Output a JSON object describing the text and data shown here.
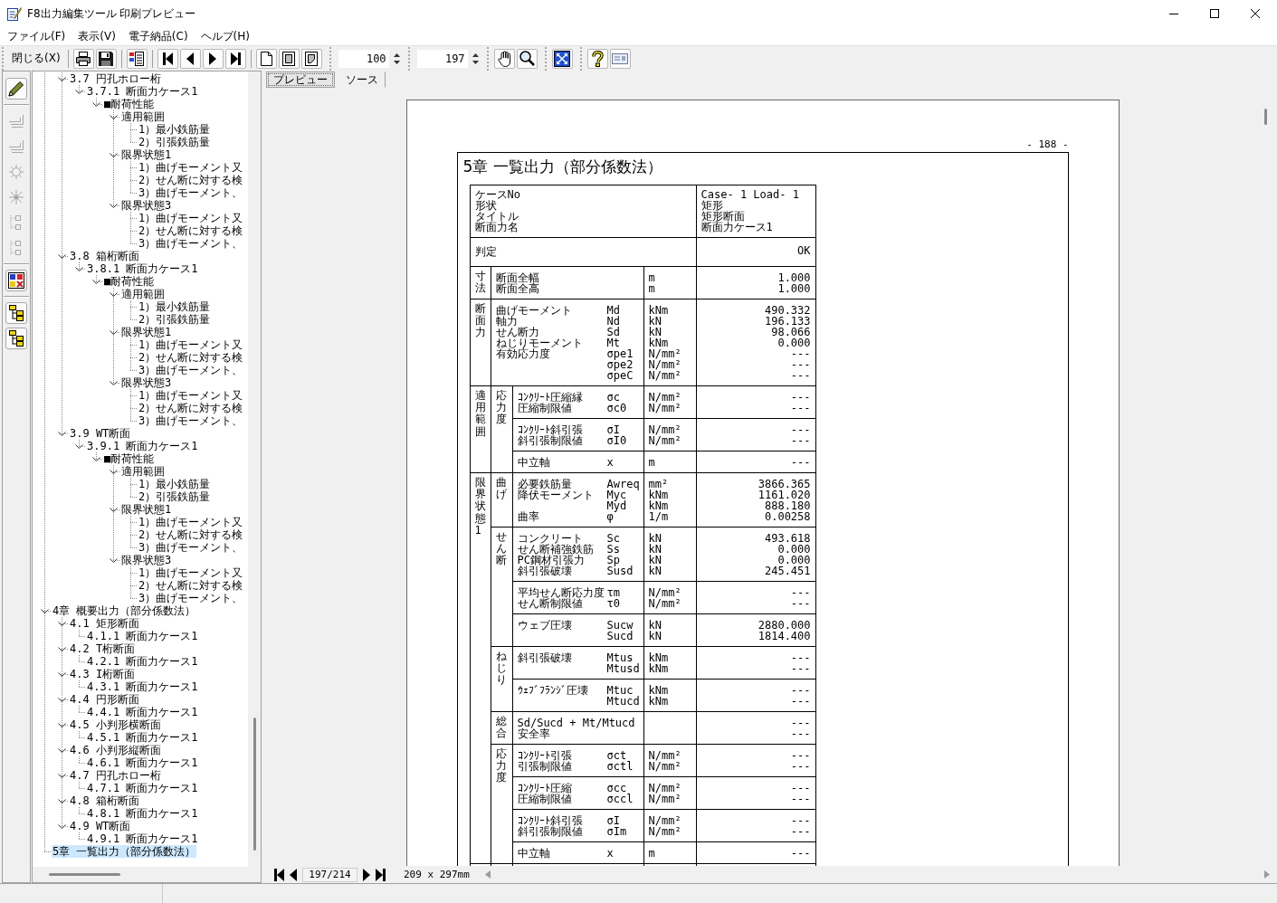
{
  "window": {
    "title": "F8出力編集ツール 印刷プレビュー"
  },
  "menu": [
    "ファイル(F)",
    "表示(V)",
    "電子納品(C)",
    "ヘルプ(H)"
  ],
  "toolbar": {
    "close_button": "閉じる(X)",
    "number_fields": [
      "100",
      "197"
    ]
  },
  "tool_strip": [
    [
      {
        "kind": "pencil",
        "disabled": false
      }
    ],
    [
      {
        "kind": "stack",
        "disabled": true
      },
      {
        "kind": "stack",
        "disabled": true
      },
      {
        "kind": "wheel",
        "disabled": true
      },
      {
        "kind": "burst",
        "disabled": true
      },
      {
        "kind": "nodes",
        "disabled": true
      },
      {
        "kind": "nodes",
        "disabled": true
      }
    ],
    [
      {
        "kind": "blocks",
        "disabled": false
      }
    ],
    [
      {
        "kind": "tree",
        "disabled": false
      },
      {
        "kind": "tree",
        "disabled": false
      }
    ]
  ],
  "tree": {
    "continued_children": [
      {
        "label": "3.7 円孔ホロー桁",
        "expanded": true,
        "selected": false,
        "children": [
          {
            "label": "3.7.1 断面力ケース1",
            "expanded": true,
            "selected": false,
            "children": [
              {
                "label": "■耐荷性能",
                "expanded": true,
                "selected": false,
                "children": [
                  {
                    "label": "適用範囲",
                    "expanded": true,
                    "selected": false,
                    "children": [
                      {
                        "label": "1）最小鉄筋量",
                        "selected": false
                      },
                      {
                        "label": "2）引張鉄筋量",
                        "selected": false
                      }
                    ]
                  },
                  {
                    "label": "限界状態1",
                    "expanded": true,
                    "selected": false,
                    "children": [
                      {
                        "label": "1）曲げモーメント又",
                        "selected": false
                      },
                      {
                        "label": "2）せん断に対する検",
                        "selected": false
                      },
                      {
                        "label": "3）曲げモーメント、",
                        "selected": false
                      }
                    ]
                  },
                  {
                    "label": "限界状態3",
                    "expanded": true,
                    "selected": false,
                    "children": [
                      {
                        "label": "1）曲げモーメント又",
                        "selected": false
                      },
                      {
                        "label": "2）せん断に対する検",
                        "selected": false
                      },
                      {
                        "label": "3）曲げモーメント、",
                        "selected": false
                      }
                    ]
                  }
                ]
              }
            ]
          }
        ]
      },
      {
        "label": "3.8 箱桁断面",
        "expanded": true,
        "selected": false,
        "children": [
          {
            "label": "3.8.1 断面力ケース1",
            "expanded": true,
            "selected": false,
            "children": [
              {
                "label": "■耐荷性能",
                "expanded": true,
                "selected": false,
                "children": [
                  {
                    "label": "適用範囲",
                    "expanded": true,
                    "selected": false,
                    "children": [
                      {
                        "label": "1）最小鉄筋量",
                        "selected": false
                      },
                      {
                        "label": "2）引張鉄筋量",
                        "selected": false
                      }
                    ]
                  },
                  {
                    "label": "限界状態1",
                    "expanded": true,
                    "selected": false,
                    "children": [
                      {
                        "label": "1）曲げモーメント又",
                        "selected": false
                      },
                      {
                        "label": "2）せん断に対する検",
                        "selected": false
                      },
                      {
                        "label": "3）曲げモーメント、",
                        "selected": false
                      }
                    ]
                  },
                  {
                    "label": "限界状態3",
                    "expanded": true,
                    "selected": false,
                    "children": [
                      {
                        "label": "1）曲げモーメント又",
                        "selected": false
                      },
                      {
                        "label": "2）せん断に対する検",
                        "selected": false
                      },
                      {
                        "label": "3）曲げモーメント、",
                        "selected": false
                      }
                    ]
                  }
                ]
              }
            ]
          }
        ]
      },
      {
        "label": "3.9 WT断面",
        "expanded": true,
        "selected": false,
        "children": [
          {
            "label": "3.9.1 断面力ケース1",
            "expanded": true,
            "selected": false,
            "children": [
              {
                "label": "■耐荷性能",
                "expanded": true,
                "selected": false,
                "children": [
                  {
                    "label": "適用範囲",
                    "expanded": true,
                    "selected": false,
                    "children": [
                      {
                        "label": "1）最小鉄筋量",
                        "selected": false
                      },
                      {
                        "label": "2）引張鉄筋量",
                        "selected": false
                      }
                    ]
                  },
                  {
                    "label": "限界状態1",
                    "expanded": true,
                    "selected": false,
                    "children": [
                      {
                        "label": "1）曲げモーメント又",
                        "selected": false
                      },
                      {
                        "label": "2）せん断に対する検",
                        "selected": false
                      },
                      {
                        "label": "3）曲げモーメント、",
                        "selected": false
                      }
                    ]
                  },
                  {
                    "label": "限界状態3",
                    "expanded": true,
                    "selected": false,
                    "children": [
                      {
                        "label": "1）曲げモーメント又",
                        "selected": false
                      },
                      {
                        "label": "2）せん断に対する検",
                        "selected": false
                      },
                      {
                        "label": "3）曲げモーメント、",
                        "selected": false
                      }
                    ]
                  }
                ]
              }
            ]
          }
        ]
      }
    ],
    "items": [
      {
        "label": "4章 概要出力（部分係数法）",
        "expanded": true,
        "selected": false,
        "children": [
          {
            "label": "4.1 矩形断面",
            "expanded": true,
            "selected": false,
            "children": [
              {
                "label": "4.1.1 断面力ケース1",
                "selected": false
              }
            ]
          },
          {
            "label": "4.2 T桁断面",
            "expanded": true,
            "selected": false,
            "children": [
              {
                "label": "4.2.1 断面力ケース1",
                "selected": false
              }
            ]
          },
          {
            "label": "4.3 I桁断面",
            "expanded": true,
            "selected": false,
            "children": [
              {
                "label": "4.3.1 断面力ケース1",
                "selected": false
              }
            ]
          },
          {
            "label": "4.4 円形断面",
            "expanded": true,
            "selected": false,
            "children": [
              {
                "label": "4.4.1 断面力ケース1",
                "selected": false
              }
            ]
          },
          {
            "label": "4.5 小判形横断面",
            "expanded": true,
            "selected": false,
            "children": [
              {
                "label": "4.5.1 断面力ケース1",
                "selected": false
              }
            ]
          },
          {
            "label": "4.6 小判形縦断面",
            "expanded": true,
            "selected": false,
            "children": [
              {
                "label": "4.6.1 断面力ケース1",
                "selected": false
              }
            ]
          },
          {
            "label": "4.7 円孔ホロー桁",
            "expanded": true,
            "selected": false,
            "children": [
              {
                "label": "4.7.1 断面力ケース1",
                "selected": false
              }
            ]
          },
          {
            "label": "4.8 箱桁断面",
            "expanded": true,
            "selected": false,
            "children": [
              {
                "label": "4.8.1 断面力ケース1",
                "selected": false
              }
            ]
          },
          {
            "label": "4.9 WT断面",
            "expanded": true,
            "selected": false,
            "children": [
              {
                "label": "4.9.1 断面力ケース1",
                "selected": false
              }
            ]
          }
        ]
      },
      {
        "label": "5章 一覧出力（部分係数法）",
        "selected": true
      }
    ]
  },
  "tabs": [
    {
      "label": "プレビュー",
      "selected": true
    },
    {
      "label": "ソース",
      "selected": false
    }
  ],
  "preview": {
    "page_number": "- 188 -",
    "heading": "5章 一覧出力（部分係数法）",
    "table": {
      "header": {
        "labels": [
          "ケースNo",
          "形状",
          "タイトル",
          "断面力名"
        ],
        "values": [
          "Case- 1 Load- 1",
          "矩形",
          "矩形断面",
          "断面力ケース1"
        ]
      },
      "verdict": {
        "label": "判定",
        "value": "OK"
      },
      "groups": [
        {
          "label": "寸法",
          "blocks": [
            {
              "lines": [
                {
                  "item": "断面全幅",
                  "unit": "m",
                  "value": "1.000"
                },
                {
                  "item": "断面全高",
                  "unit": "m",
                  "value": "1.000"
                }
              ]
            }
          ]
        },
        {
          "label": "断面力",
          "blocks": [
            {
              "lines": [
                {
                  "item": "曲げモーメント",
                  "symbol": "Md",
                  "unit": "kNm",
                  "value": "490.332"
                },
                {
                  "item": "軸力",
                  "symbol": "Nd",
                  "unit": "kN",
                  "value": "196.133"
                },
                {
                  "item": "せん断力",
                  "symbol": "Sd",
                  "unit": "kN",
                  "value": "98.066"
                },
                {
                  "item": "ねじりモーメント",
                  "symbol": "Mt",
                  "unit": "kNm",
                  "value": "0.000"
                },
                {
                  "item": "有効応力度",
                  "symbol": "σpe1",
                  "unit": "N/mm²",
                  "value": "---"
                },
                {
                  "symbol": "σpe2",
                  "unit": "N/mm²",
                  "value": "---"
                },
                {
                  "symbol": "σpeC",
                  "unit": "N/mm²",
                  "value": "---"
                }
              ]
            }
          ]
        },
        {
          "label": "適用範囲",
          "subgroups": [
            {
              "label": "応力度",
              "blocks": [
                {
                  "lines": [
                    {
                      "item": "ｺﾝｸﾘｰﾄ圧縮縁",
                      "symbol": "σc",
                      "unit": "N/mm²",
                      "value": "---"
                    },
                    {
                      "item": "圧縮制限値",
                      "symbol": "σc0",
                      "unit": "N/mm²",
                      "value": "---"
                    }
                  ]
                },
                {
                  "lines": [
                    {
                      "item": "ｺﾝｸﾘｰﾄ斜引張",
                      "symbol": "σI",
                      "unit": "N/mm²",
                      "value": "---"
                    },
                    {
                      "item": "斜引張制限値",
                      "symbol": "σI0",
                      "unit": "N/mm²",
                      "value": "---"
                    }
                  ]
                },
                {
                  "lines": [
                    {
                      "item": "中立軸",
                      "symbol": "x",
                      "unit": "m",
                      "value": "---"
                    }
                  ]
                }
              ]
            }
          ]
        },
        {
          "label": "限界状態1",
          "subgroups": [
            {
              "label": "曲げ",
              "blocks": [
                {
                  "lines": [
                    {
                      "item": "必要鉄筋量",
                      "symbol": "Awreq",
                      "unit": "mm²",
                      "value": "3866.365"
                    },
                    {
                      "item": "降伏モーメント",
                      "symbol": "Myc",
                      "unit": "kNm",
                      "value": "1161.020"
                    },
                    {
                      "symbol": "Myd",
                      "unit": "kNm",
                      "value": "888.180"
                    },
                    {
                      "item": "曲率",
                      "symbol": "φ",
                      "unit": "1/m",
                      "value": "0.00258"
                    }
                  ]
                }
              ]
            },
            {
              "label": "せん断",
              "blocks": [
                {
                  "lines": [
                    {
                      "item": "コンクリート",
                      "symbol": "Sc",
                      "unit": "kN",
                      "value": "493.618"
                    },
                    {
                      "item": "せん断補強鉄筋",
                      "symbol": "Ss",
                      "unit": "kN",
                      "value": "0.000"
                    },
                    {
                      "item": "PC鋼材引張力",
                      "symbol": "Sp",
                      "unit": "kN",
                      "value": "0.000"
                    },
                    {
                      "item": "斜引張破壊",
                      "symbol": "Susd",
                      "unit": "kN",
                      "value": "245.451"
                    }
                  ]
                },
                {
                  "lines": [
                    {
                      "item": "平均せん断応力度",
                      "symbol": "τm",
                      "unit": "N/mm²",
                      "value": "---"
                    },
                    {
                      "item": "せん断制限値",
                      "symbol": "τ0",
                      "unit": "N/mm²",
                      "value": "---"
                    }
                  ]
                },
                {
                  "lines": [
                    {
                      "item": "ウェブ圧壊",
                      "symbol": "Sucw",
                      "unit": "kN",
                      "value": "2880.000"
                    },
                    {
                      "symbol": "Sucd",
                      "unit": "kN",
                      "value": "1814.400"
                    }
                  ]
                }
              ]
            },
            {
              "label": "ねじり",
              "blocks": [
                {
                  "lines": [
                    {
                      "item": "斜引張破壊",
                      "symbol": "Mtus",
                      "unit": "kNm",
                      "value": "---"
                    },
                    {
                      "symbol": "Mtusd",
                      "unit": "kNm",
                      "value": "---"
                    }
                  ]
                },
                {
                  "lines": [
                    {
                      "item": "ｳｪﾌﾞﾌﾗﾝｼﾞ圧壊",
                      "symbol": "Mtuc",
                      "unit": "kNm",
                      "value": "---"
                    },
                    {
                      "symbol": "Mtucd",
                      "unit": "kNm",
                      "value": "---"
                    }
                  ]
                }
              ]
            },
            {
              "label": "総合",
              "blocks": [
                {
                  "lines": [
                    {
                      "item": "Sd/Sucd + Mt/Mtucd",
                      "value": "---"
                    },
                    {
                      "item": "安全率",
                      "value": "---"
                    }
                  ]
                }
              ]
            },
            {
              "label": "応力度",
              "blocks": [
                {
                  "lines": [
                    {
                      "item": "ｺﾝｸﾘｰﾄ引張",
                      "symbol": "σct",
                      "unit": "N/mm²",
                      "value": "---"
                    },
                    {
                      "item": "引張制限値",
                      "symbol": "σctl",
                      "unit": "N/mm²",
                      "value": "---"
                    }
                  ]
                },
                {
                  "lines": [
                    {
                      "item": "ｺﾝｸﾘｰﾄ圧縮",
                      "symbol": "σcc",
                      "unit": "N/mm²",
                      "value": "---"
                    },
                    {
                      "item": "圧縮制限値",
                      "symbol": "σccl",
                      "unit": "N/mm²",
                      "value": "---"
                    }
                  ]
                },
                {
                  "lines": [
                    {
                      "item": "ｺﾝｸﾘｰﾄ斜引張",
                      "symbol": "σI",
                      "unit": "N/mm²",
                      "value": "---"
                    },
                    {
                      "item": "斜引張制限値",
                      "symbol": "σIm",
                      "unit": "N/mm²",
                      "value": "---"
                    }
                  ]
                },
                {
                  "lines": [
                    {
                      "item": "中立軸",
                      "symbol": "x",
                      "unit": "m",
                      "value": "---"
                    }
                  ]
                }
              ]
            }
          ]
        }
      ]
    }
  },
  "navigator": {
    "page_field": "197/214",
    "paper_size": "209 x 297mm"
  }
}
